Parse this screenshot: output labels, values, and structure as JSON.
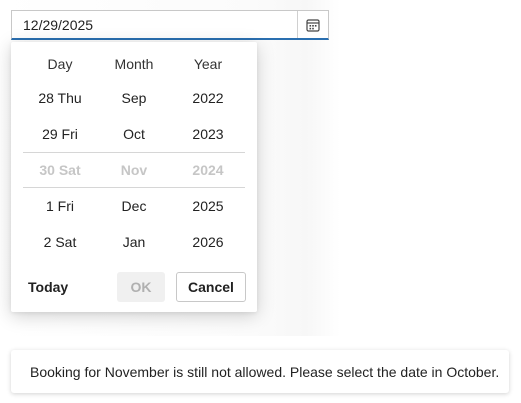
{
  "date_input": {
    "value": "12/29/2025",
    "icon": "calendar-icon"
  },
  "picker": {
    "headers": {
      "day": "Day",
      "month": "Month",
      "year": "Year"
    },
    "days": [
      "28 Thu",
      "29 Fri",
      "30 Sat",
      "1 Fri",
      "2 Sat"
    ],
    "months": [
      "Sep",
      "Oct",
      "Nov",
      "Dec",
      "Jan"
    ],
    "years": [
      "2022",
      "2023",
      "2024",
      "2025",
      "2026"
    ],
    "selected_row_disabled": true
  },
  "buttons": {
    "today": "Today",
    "ok": "OK",
    "cancel": "Cancel"
  },
  "toast": {
    "message": "Booking for November is still not allowed. Please select the date in October."
  }
}
